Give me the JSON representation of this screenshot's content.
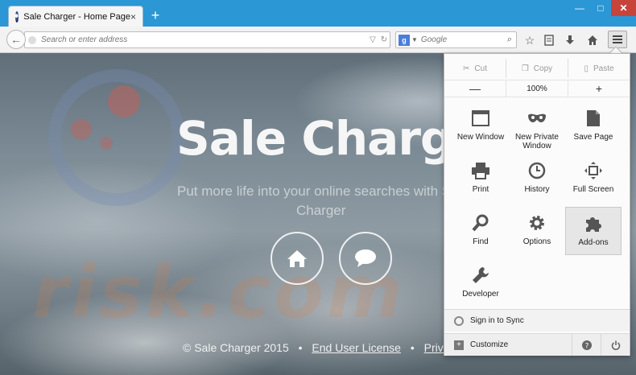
{
  "window": {
    "tab_title": "Sale Charger - Home Page",
    "tab_close": "×",
    "new_tab": "+",
    "minimize": "—",
    "maximize": "□",
    "close": "✕"
  },
  "navbar": {
    "url_placeholder": "Search or enter address",
    "search_engine": "g",
    "search_placeholder": "Google"
  },
  "page": {
    "title": "Sale Charger",
    "subtitle_line1": "Put more life into your online searches with S",
    "subtitle_line2": "Charger",
    "watermark": "risk.com",
    "footer": {
      "copyright": "© Sale Charger 2015",
      "bullet": "•",
      "eula": "End User License",
      "privacy": "Privacy Polic"
    }
  },
  "menu_panel": {
    "edit": {
      "cut": "Cut",
      "copy": "Copy",
      "paste": "Paste"
    },
    "zoom": {
      "minus": "—",
      "level": "100%",
      "plus": "+"
    },
    "items": [
      {
        "label": "New Window",
        "icon": "window-icon"
      },
      {
        "label": "New Private Window",
        "icon": "mask-icon"
      },
      {
        "label": "Save Page",
        "icon": "page-icon"
      },
      {
        "label": "Print",
        "icon": "printer-icon"
      },
      {
        "label": "History",
        "icon": "clock-icon"
      },
      {
        "label": "Full Screen",
        "icon": "fullscreen-icon"
      },
      {
        "label": "Find",
        "icon": "magnifier-icon"
      },
      {
        "label": "Options",
        "icon": "gear-icon"
      },
      {
        "label": "Add-ons",
        "icon": "puzzle-icon"
      },
      {
        "label": "Developer",
        "icon": "wrench-icon"
      }
    ],
    "sign_in": "Sign in to Sync",
    "customize": "Customize"
  }
}
